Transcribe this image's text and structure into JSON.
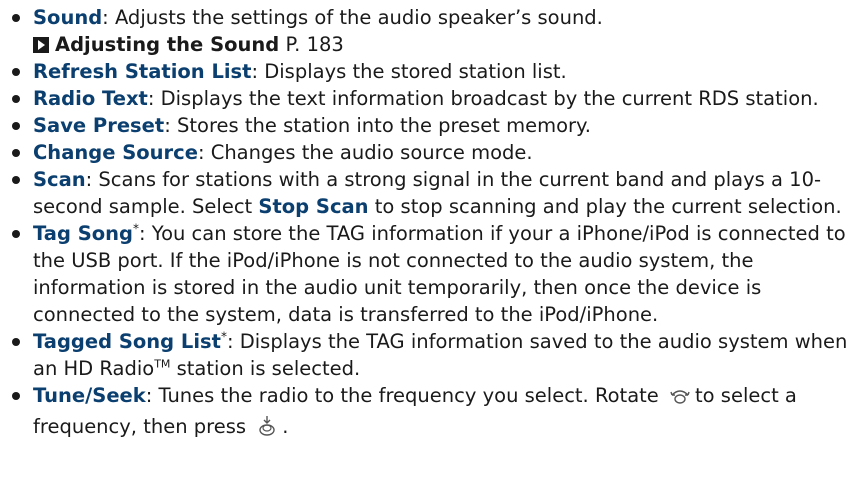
{
  "items": [
    {
      "term": "Sound",
      "desc": ": Adjusts the settings of the audio speaker’s sound."
    },
    {
      "term": "Refresh Station List",
      "desc": ": Displays the stored station list."
    },
    {
      "term": "Radio Text",
      "desc": ": Displays the text information broadcast by the current RDS station."
    },
    {
      "term": "Save Preset",
      "desc": ": Stores the station into the preset memory."
    },
    {
      "term": "Change Source",
      "desc": ": Changes the audio source mode."
    },
    {
      "term": "Scan",
      "desc_a": ": Scans for stations with a strong signal in the current band and plays a 10-second sample. Select ",
      "inline_term": "Stop Scan",
      "desc_b": " to stop scanning and play the current selection."
    },
    {
      "term": "Tag Song",
      "marker": "*",
      "desc": ": You can store the TAG information if your a iPhone/iPod is connected to the USB port. If the iPod/iPhone is not connected to the audio system, the information is stored in the audio unit temporarily, then once the device is connected to the system, data is transferred to the iPod/iPhone."
    },
    {
      "term": "Tagged Song List",
      "marker": "*",
      "desc_a": ": Displays the TAG information saved to the audio system when an HD Radio",
      "tm": "TM",
      "desc_b": " station is selected."
    },
    {
      "term": "Tune/Seek",
      "desc_a": ": Tunes the radio to the frequency you select. Rotate",
      "desc_b": "to select a frequency, then press",
      "desc_c": "."
    }
  ],
  "reference": {
    "title": "Adjusting the Sound",
    "page": "P. 183"
  },
  "icons": {
    "rotate": "interface-dial-rotate-icon",
    "press": "interface-dial-press-icon"
  }
}
